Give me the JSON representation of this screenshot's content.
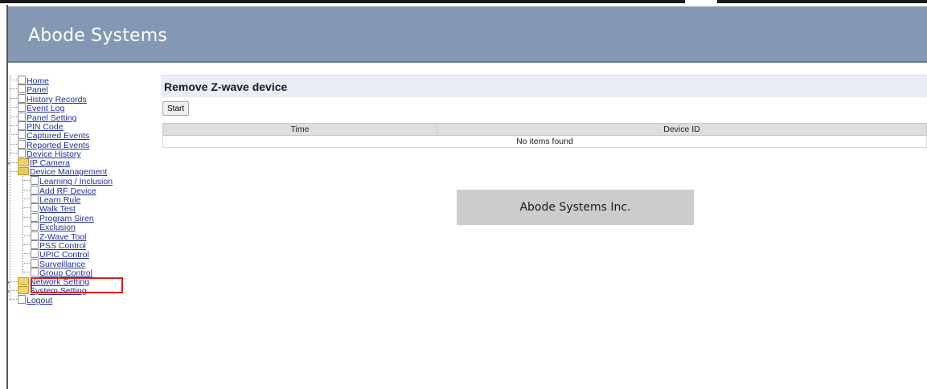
{
  "header": {
    "title": "Abode Systems"
  },
  "sidebar": {
    "items": [
      {
        "label": "Home",
        "level": 1,
        "type": "doc"
      },
      {
        "label": "Panel",
        "level": 1,
        "type": "doc"
      },
      {
        "label": "History Records",
        "level": 1,
        "type": "doc"
      },
      {
        "label": "Event Log",
        "level": 1,
        "type": "doc"
      },
      {
        "label": "Panel Setting",
        "level": 1,
        "type": "doc"
      },
      {
        "label": "PIN Code",
        "level": 1,
        "type": "doc"
      },
      {
        "label": "Captured Events",
        "level": 1,
        "type": "doc"
      },
      {
        "label": "Reported Events",
        "level": 1,
        "type": "doc"
      },
      {
        "label": "Device History",
        "level": 1,
        "type": "doc"
      },
      {
        "label": "IP Camera",
        "level": 1,
        "type": "folder"
      },
      {
        "label": "Device Management",
        "level": 1,
        "type": "folder-open"
      },
      {
        "label": "Learning / Inclusion",
        "level": 2,
        "type": "doc"
      },
      {
        "label": "Add RF Device",
        "level": 2,
        "type": "doc"
      },
      {
        "label": "Learn Rule",
        "level": 2,
        "type": "doc"
      },
      {
        "label": "Walk Test",
        "level": 2,
        "type": "doc"
      },
      {
        "label": "Program Siren",
        "level": 2,
        "type": "doc"
      },
      {
        "label": "Exclusion",
        "level": 2,
        "type": "doc",
        "highlighted": true
      },
      {
        "label": "Z-Wave Tool",
        "level": 2,
        "type": "doc"
      },
      {
        "label": "PSS Control",
        "level": 2,
        "type": "doc"
      },
      {
        "label": "UPIC Control",
        "level": 2,
        "type": "doc"
      },
      {
        "label": "Surveillance",
        "level": 2,
        "type": "doc"
      },
      {
        "label": "Group Control",
        "level": 2,
        "type": "doc"
      },
      {
        "label": "Network Setting",
        "level": 1,
        "type": "folder"
      },
      {
        "label": "System Setting",
        "level": 1,
        "type": "folder"
      },
      {
        "label": "Logout",
        "level": 1,
        "type": "doc"
      }
    ]
  },
  "main": {
    "title": "Remove Z-wave device",
    "start_label": "Start",
    "table": {
      "columns": [
        "Time",
        "Device ID"
      ],
      "empty_text": "No items found"
    },
    "footer_text": "Abode Systems Inc."
  },
  "colors": {
    "header_bg": "#8498b4",
    "title_bar_bg": "#e9eef8",
    "highlight_border": "#e41b1b"
  }
}
